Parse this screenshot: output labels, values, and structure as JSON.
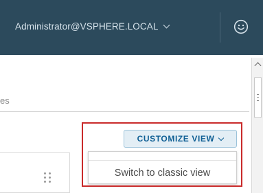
{
  "header": {
    "user_label": "Administrator@VSPHERE.LOCAL",
    "user_menu_icon": "chevron-down-icon",
    "help_icon": "smiley-face-icon",
    "colors": {
      "background": "#2c4a5c",
      "text": "#d6e2ea"
    }
  },
  "main": {
    "partial_label": "es",
    "customize_view": {
      "label": "CUSTOMIZE VIEW",
      "icon": "chevron-down-icon",
      "colors": {
        "background": "#e3eef5",
        "text": "#0f5f94",
        "border": "#9cc3da"
      }
    },
    "dropdown": {
      "items": [
        {
          "label": "Switch to classic view"
        }
      ]
    },
    "annotation_color": "#c92a2a",
    "card": {
      "drag_icon": "drag-handle-icon"
    },
    "scrollbar": {
      "up_icon": "chevron-up-icon"
    }
  }
}
